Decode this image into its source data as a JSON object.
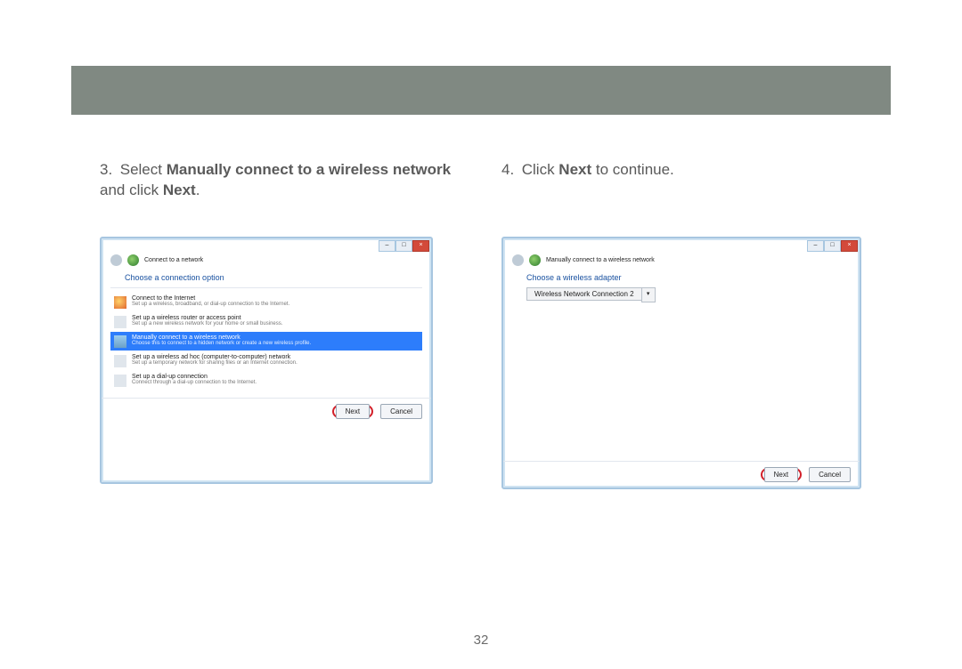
{
  "page_number": "32",
  "step3": {
    "num": "3.",
    "text_before_bold1": "Select ",
    "bold1": "Manually connect to a wireless network",
    "between": " and click ",
    "bold2": "Next",
    "after": "."
  },
  "step4": {
    "num": "4.",
    "text_before_bold": "Click ",
    "bold": "Next",
    "after": " to continue."
  },
  "dlg1": {
    "title": "Connect to a network",
    "section": "Choose a connection option",
    "options": [
      {
        "title": "Connect to the Internet",
        "sub": "Set up a wireless, broadband, or dial-up connection to the Internet."
      },
      {
        "title": "Set up a wireless router or access point",
        "sub": "Set up a new wireless network for your home or small business."
      },
      {
        "title": "Manually connect to a wireless network",
        "sub": "Choose this to connect to a hidden network or create a new wireless profile."
      },
      {
        "title": "Set up a wireless ad hoc (computer-to-computer) network",
        "sub": "Set up a temporary network for sharing files or an Internet connection."
      },
      {
        "title": "Set up a dial-up connection",
        "sub": "Connect through a dial-up connection to the Internet."
      }
    ],
    "next": "Next",
    "cancel": "Cancel"
  },
  "dlg2": {
    "title": "Manually connect to a wireless network",
    "section": "Choose a wireless adapter",
    "adapter": "Wireless Network Connection 2",
    "next": "Next",
    "cancel": "Cancel"
  }
}
